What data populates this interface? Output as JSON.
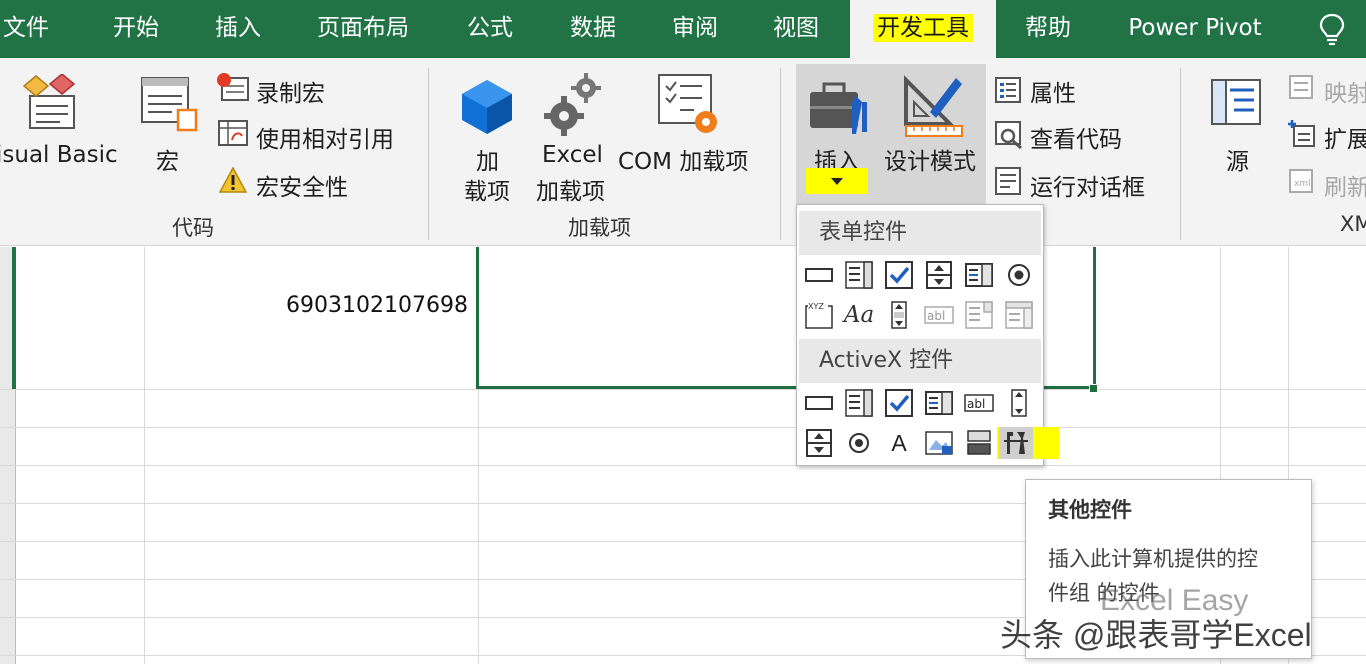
{
  "tabs": [
    {
      "label": "文件"
    },
    {
      "label": "开始"
    },
    {
      "label": "插入"
    },
    {
      "label": "页面布局"
    },
    {
      "label": "公式"
    },
    {
      "label": "数据"
    },
    {
      "label": "审阅"
    },
    {
      "label": "视图"
    },
    {
      "label": "开发工具",
      "active": true
    },
    {
      "label": "帮助"
    },
    {
      "label": "Power Pivot"
    }
  ],
  "tab_icons": {
    "tell_me": "lightbulb-icon"
  },
  "ribbon": {
    "code": {
      "group_label": "代码",
      "visual_basic": "isual Basic",
      "macros": "宏",
      "record_macro": "录制宏",
      "use_relative": "使用相对引用",
      "macro_security": "宏安全性"
    },
    "addins": {
      "group_label": "加载项",
      "addins_line1": "加",
      "addins_line2": "载项",
      "excel_line1": "Excel",
      "excel_line2": "加载项",
      "com_addins": "COM 加载项"
    },
    "controls": {
      "insert": "插入",
      "design_mode": "设计模式",
      "properties": "属性",
      "view_code": "查看代码",
      "run_dialog": "运行对话框"
    },
    "xml": {
      "source": "源",
      "map_props": "映射",
      "expansion_packs": "扩展",
      "refresh_data": "刷新",
      "group_label": "XM"
    }
  },
  "sheet": {
    "cell_value": "6903102107698"
  },
  "insert_panel": {
    "form_controls_header": "表单控件",
    "activex_header": "ActiveX 控件",
    "form_controls": [
      "button-icon",
      "combo-box-icon",
      "checkbox-icon",
      "spin-button-icon",
      "list-box-icon",
      "option-button-icon",
      "group-box-icon",
      "label-icon",
      "scroll-bar-icon",
      "text-field-icon",
      "combo-list-edit-icon",
      "combo-drop-down-edit-icon"
    ],
    "activex_controls": [
      "command-button-icon",
      "combo-box-icon",
      "checkbox-icon",
      "list-box-icon",
      "text-box-icon",
      "scroll-bar-icon",
      "spin-button-icon",
      "option-button-icon",
      "label-icon",
      "image-icon",
      "toggle-button-icon",
      "more-controls-icon"
    ],
    "label_glyph": "A",
    "text_glyph": "abl",
    "aa_glyph": "Aa",
    "xyz_glyph": "XYZ"
  },
  "tooltip": {
    "title": "其他控件",
    "line1": "插入此计算机提供的控",
    "line2": "件组 的控件"
  },
  "watermark": {
    "line1": "Excel Easy",
    "line2": "头条 @跟表哥学Excel"
  },
  "colors": {
    "brand": "#217346",
    "highlight": "#ffff00",
    "selection": "#1e6e3e",
    "check_blue": "#1f5fbf",
    "gear_orange": "#f07c1a"
  }
}
